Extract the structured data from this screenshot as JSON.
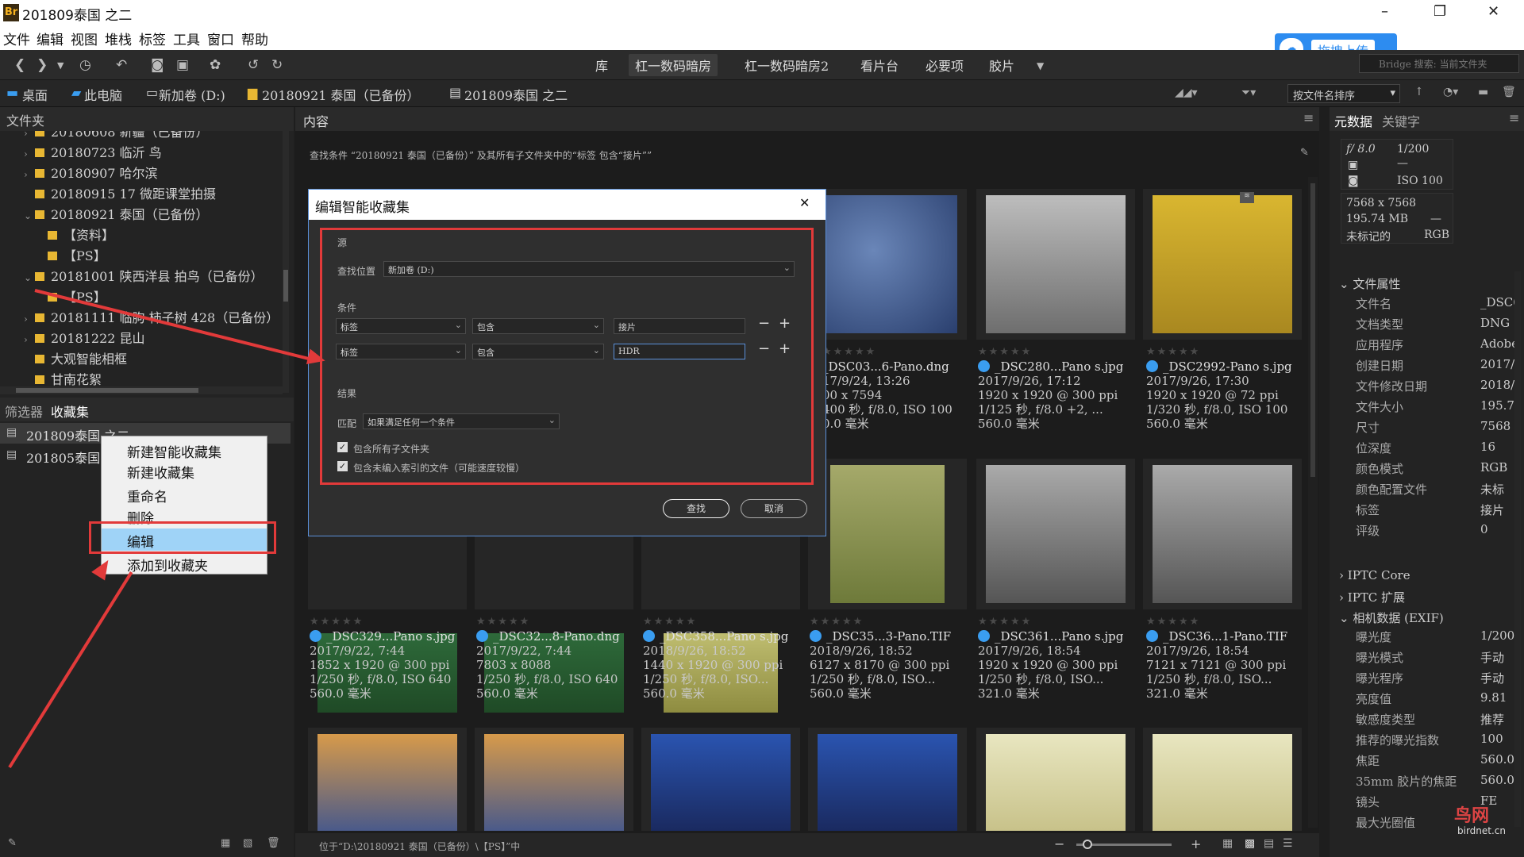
{
  "window": {
    "title": "201809泰国 之二",
    "app_badge": "Br",
    "min": "–",
    "max": "❐",
    "close": "✕"
  },
  "menu": [
    "文件",
    "编辑",
    "视图",
    "堆栈",
    "标签",
    "工具",
    "窗口",
    "帮助"
  ],
  "workspaces": [
    "库",
    "杠一数码暗房",
    "杠一数码暗房2",
    "看片台",
    "必要项",
    "胶片"
  ],
  "upload": {
    "label": "拖拽上传"
  },
  "search": {
    "placeholder": "Bridge 搜索: 当前文件夹"
  },
  "breadcrumb": [
    "桌面",
    "此电脑",
    "新加卷 (D:)",
    "20180921 泰国（已备份）",
    "201809泰国 之二"
  ],
  "sort": {
    "label": "按文件名排序"
  },
  "left": {
    "folders_tab": "文件夹",
    "tree": [
      {
        "label": "20180608 新疆（已备份）",
        "level": 0
      },
      {
        "label": "20180723 临沂 鸟",
        "level": 0
      },
      {
        "label": "20180907 哈尔滨",
        "level": 0
      },
      {
        "label": "20180915 17 微距课堂拍摄",
        "level": 0
      },
      {
        "label": "20180921 泰国（已备份）",
        "level": 0,
        "open": true
      },
      {
        "label": "【资料】",
        "level": 1
      },
      {
        "label": "【PS】",
        "level": 1
      },
      {
        "label": "20181001 陕西洋县 拍鸟（已备份）",
        "level": 0,
        "open": true
      },
      {
        "label": "【PS】",
        "level": 1
      },
      {
        "label": "20181111 临朐 柿子树 428（已备份）",
        "level": 0
      },
      {
        "label": "20181222 昆山",
        "level": 0
      },
      {
        "label": "大观智能相框",
        "level": 0
      },
      {
        "label": "甘南花絮",
        "level": 0
      }
    ],
    "filter_tab": "筛选器",
    "collections_tab": "收藏集",
    "collections": [
      "201809泰国 之二",
      "201805泰国"
    ]
  },
  "context_menu": [
    "新建智能收藏集",
    "新建收藏集",
    "重命名",
    "删除",
    "编辑",
    "添加到收藏夹"
  ],
  "content": {
    "tab": "内容",
    "query": "查找条件  “20180921 泰国（已备份）” 及其所有子文件夹中的“标签 包含“接片””",
    "status": "位于“D:\\20180921 泰国（已备份）\\【PS】”中"
  },
  "dialog": {
    "title": "编辑智能收藏集",
    "source_label": "源",
    "look_in_label": "查找位置",
    "look_in_value": "新加卷 (D:)",
    "criteria_label": "条件",
    "criteria": [
      {
        "field": "标签",
        "op": "包含",
        "value": "接片"
      },
      {
        "field": "标签",
        "op": "包含",
        "value": "HDR"
      }
    ],
    "results_label": "结果",
    "match_label": "匹配",
    "match_value": "如果满足任何一个条件",
    "check1": "包含所有子文件夹",
    "check2": "包含未编入索引的文件（可能速度较慢）",
    "find": "查找",
    "cancel": "取消"
  },
  "thumbs_row1": [
    {
      "name": "_DSC03...6-Pano.dng",
      "date": "17/9/24, 13:26",
      "dim": "00 x 7594",
      "exp": "400 秒, f/8.0, ISO 100",
      "focal": "0.0 毫米",
      "dot": false
    },
    {
      "name": "_DSC280...Pano s.jpg",
      "date": "2017/9/26, 17:12",
      "dim": "1920 x 1920 @ 300 ppi",
      "exp": "1/125 秒, f/8.0 +2, ...",
      "focal": "560.0 毫米",
      "dot": true
    },
    {
      "name": "_DSC2992-Pano s.jpg",
      "date": "2017/9/26, 17:30",
      "dim": "1920 x 1920 @ 72 ppi",
      "exp": "1/320 秒, f/8.0, ISO 100",
      "focal": "560.0 毫米",
      "dot": true
    }
  ],
  "thumbs_row2": [
    {
      "name": "_DSC329...Pano s.jpg",
      "date": "2017/9/22, 7:44",
      "dim": "1852 x 1920 @ 300 ppi",
      "exp": "1/250 秒, f/8.0, ISO 640",
      "focal": "560.0 毫米"
    },
    {
      "name": "_DSC32...8-Pano.dng",
      "date": "2017/9/22, 7:44",
      "dim": "7803 x 8088",
      "exp": "1/250 秒, f/8.0, ISO 640",
      "focal": "560.0 毫米"
    },
    {
      "name": "_DSC358...Pano s.jpg",
      "date": "2018/9/26, 18:52",
      "dim": "1440 x 1920 @ 300 ppi",
      "exp": "1/250 秒, f/8.0, ISO...",
      "focal": "560.0 毫米"
    },
    {
      "name": "_DSC35...3-Pano.TIF",
      "date": "2018/9/26, 18:52",
      "dim": "6127 x 8170 @ 300 ppi",
      "exp": "1/250 秒, f/8.0, ISO...",
      "focal": "560.0 毫米"
    },
    {
      "name": "_DSC361...Pano s.jpg",
      "date": "2017/9/26, 18:54",
      "dim": "1920 x 1920 @ 300 ppi",
      "exp": "1/250 秒, f/8.0, ISO...",
      "focal": "321.0 毫米"
    },
    {
      "name": "_DSC36...1-Pano.TIF",
      "date": "2017/9/26, 18:54",
      "dim": "7121 x 7121 @ 300 ppi",
      "exp": "1/250 秒, f/8.0, ISO...",
      "focal": "321.0 毫米"
    }
  ],
  "right": {
    "tab_meta": "元数据",
    "tab_kw": "关键字",
    "aperture": "f/ 8.0",
    "shutter": "1/200",
    "iso": "ISO 100",
    "dash": "—",
    "size": "7568 x 7568",
    "filesize": "195.74 MB",
    "unlabeled": "未标记的",
    "mode": "RGB",
    "file_props": "文件属性",
    "rows": [
      [
        "文件名",
        "_DSC0"
      ],
      [
        "文档类型",
        "DNG"
      ],
      [
        "应用程序",
        "Adobe"
      ],
      [
        "创建日期",
        "2017/"
      ],
      [
        "文件修改日期",
        "2018/"
      ],
      [
        "文件大小",
        "195.7"
      ],
      [
        "尺寸",
        "7568"
      ],
      [
        "位深度",
        "16"
      ],
      [
        "颜色模式",
        "RGB"
      ],
      [
        "颜色配置文件",
        "未标"
      ],
      [
        "标签",
        "接片"
      ],
      [
        "评级",
        "0"
      ]
    ],
    "iptc_core": "IPTC Core",
    "iptc_ext": "IPTC 扩展",
    "exif": "相机数据 (EXIF)",
    "exif_rows": [
      [
        "曝光度",
        "1/200"
      ],
      [
        "曝光模式",
        "手动"
      ],
      [
        "曝光程序",
        "手动"
      ],
      [
        "亮度值",
        "9.81"
      ],
      [
        "敏感度类型",
        "推荐"
      ],
      [
        "推荐的曝光指数",
        "100"
      ],
      [
        "焦距",
        "560.0"
      ],
      [
        "35mm 胶片的焦距",
        "560.0"
      ],
      [
        "镜头",
        "FE"
      ],
      [
        "最大光圈值",
        ""
      ]
    ]
  },
  "watermark": {
    "text": "鸟网",
    "sub": "birdnet.cn"
  },
  "colors": {
    "accent": "#2d8cf0",
    "highlight": "#e23a3a",
    "selection": "#9fd3f7"
  }
}
